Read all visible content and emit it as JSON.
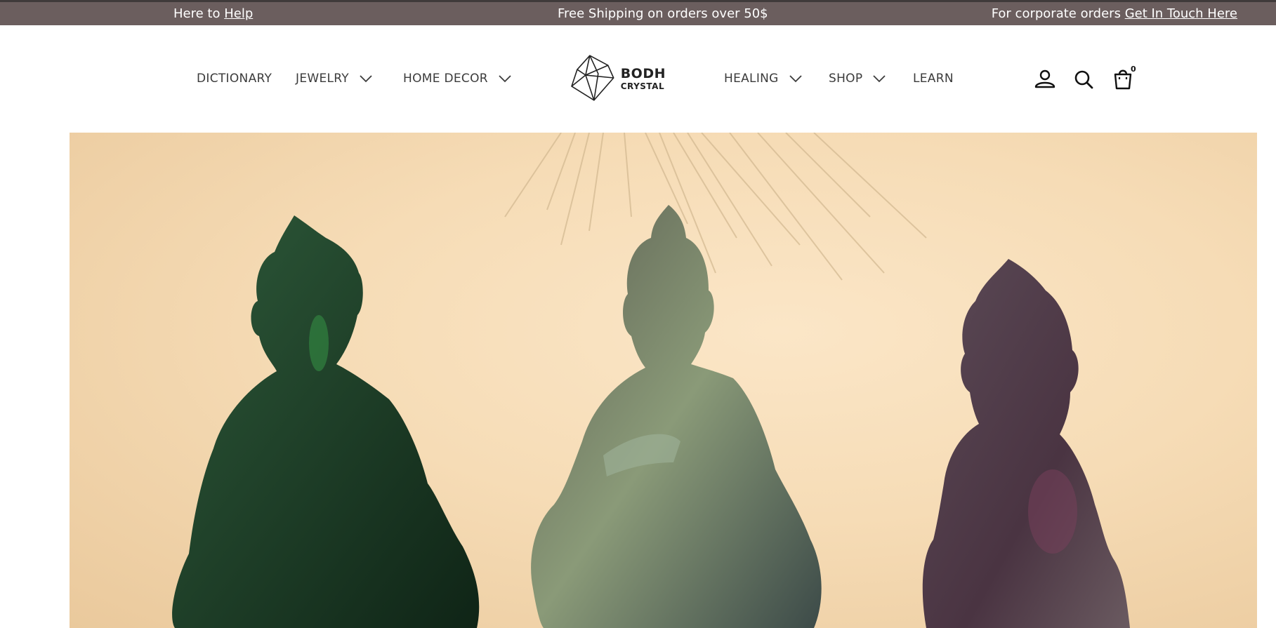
{
  "announcement": {
    "left_prefix": "Here to ",
    "left_link": "Help",
    "center": "Free Shipping on orders over 50$",
    "right_prefix": "For corporate orders ",
    "right_link": "Get In Touch Here"
  },
  "nav_left": [
    {
      "label": "DICTIONARY",
      "has_dropdown": false
    },
    {
      "label": "JEWELRY",
      "has_dropdown": true
    },
    {
      "label": "HOME DECOR",
      "has_dropdown": true
    }
  ],
  "nav_right": [
    {
      "label": "HEALING",
      "has_dropdown": true
    },
    {
      "label": "SHOP",
      "has_dropdown": true
    },
    {
      "label": "LEARN",
      "has_dropdown": false
    }
  ],
  "logo": {
    "line1": "BODH",
    "line2": "CRYSTAL"
  },
  "header_icons": [
    "account-icon",
    "search-icon",
    "cart-icon"
  ],
  "cart": {
    "count": "0"
  },
  "colors": {
    "announcement_bg": "#6b5e5e",
    "hero_bg": "#f6dcb6",
    "statue_green": "#1f3a26",
    "statue_labradorite": "#6b7560",
    "statue_fluorite": "#4a3a44"
  }
}
